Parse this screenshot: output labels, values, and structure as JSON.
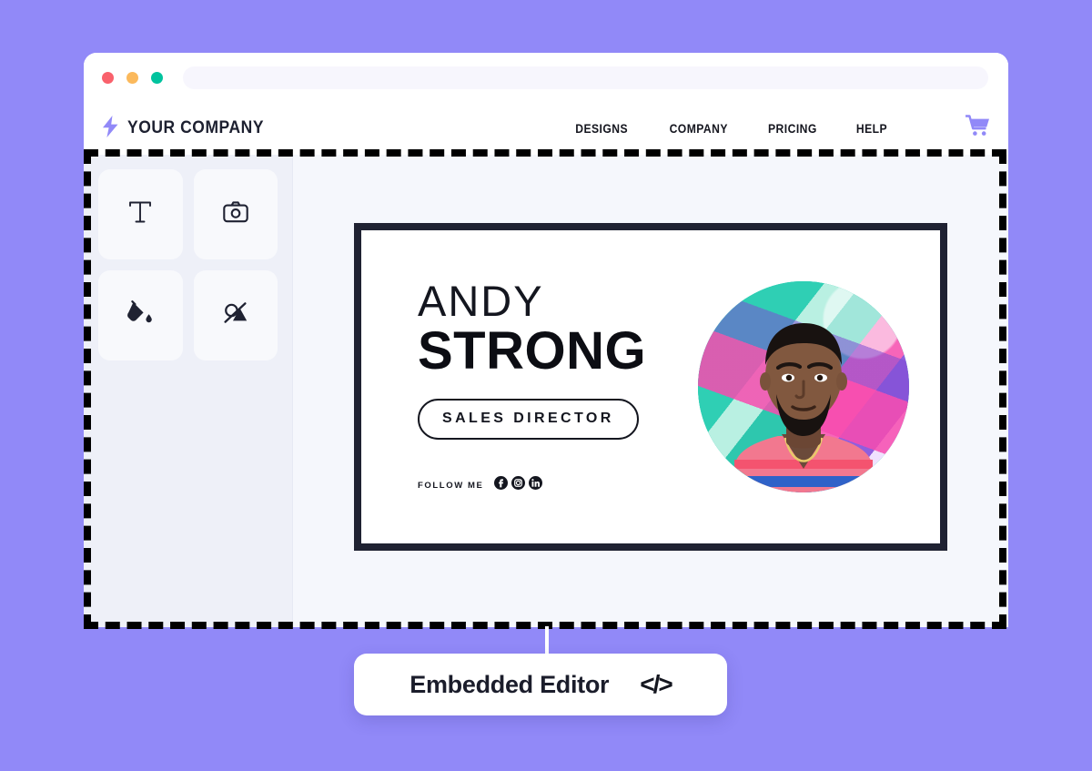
{
  "page": {
    "background_color": "#9189f8"
  },
  "browser": {
    "traffic_lights": [
      {
        "name": "close",
        "color": "#f9616c"
      },
      {
        "name": "minimize",
        "color": "#fbb95c"
      },
      {
        "name": "maximize",
        "color": "#00c39e"
      }
    ],
    "address_bar": {
      "value": "",
      "placeholder": ""
    }
  },
  "site_nav": {
    "brand": {
      "icon": "bolt-icon",
      "name": "YOUR COMPANY",
      "icon_color": "#9189f8"
    },
    "links": [
      {
        "label": "DESIGNS"
      },
      {
        "label": "COMPANY"
      },
      {
        "label": "PRICING"
      },
      {
        "label": "HELP"
      }
    ],
    "cart": {
      "icon": "shopping-cart-icon",
      "color": "#9189f8"
    }
  },
  "editor": {
    "tools": [
      {
        "name": "text-tool",
        "icon": "text-icon",
        "label": "T"
      },
      {
        "name": "photo-tool",
        "icon": "camera-icon",
        "label": ""
      },
      {
        "name": "fill-tool",
        "icon": "paint-bucket-icon",
        "label": ""
      },
      {
        "name": "shape-tool",
        "icon": "shape-crop-icon",
        "label": ""
      }
    ]
  },
  "design_card": {
    "name_first": "ANDY",
    "name_last": "STRONG",
    "role": "SALES DIRECTOR",
    "follow_label": "FOLLOW ME",
    "social": [
      {
        "name": "facebook-icon",
        "glyph": "f"
      },
      {
        "name": "instagram-icon",
        "glyph": ""
      },
      {
        "name": "linkedin-icon",
        "glyph": "in"
      }
    ],
    "photo": {
      "name": "profile-photo",
      "alt": "Portrait of a man in front of graffiti wall"
    },
    "border_color": "#1f2232"
  },
  "callout": {
    "label": "Embedded Editor",
    "icon": "code-icon",
    "icon_glyph": "</>"
  }
}
